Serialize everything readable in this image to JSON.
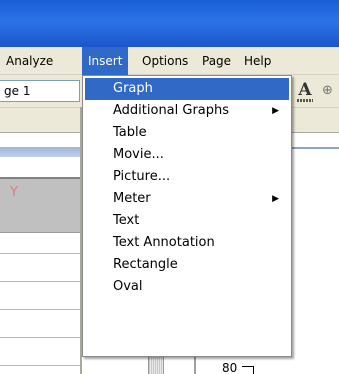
{
  "menubar": {
    "items": [
      {
        "label": "Analyze"
      },
      {
        "label": "Insert"
      },
      {
        "label": "Options"
      },
      {
        "label": "Page"
      },
      {
        "label": "Help"
      }
    ]
  },
  "toolbar": {
    "page_value": "ge 1",
    "font_color_glyph": "A",
    "zoom_glyph": "⊕"
  },
  "left_panel": {
    "column_header": "Y"
  },
  "graph": {
    "tick_label": "80"
  },
  "insert_menu": {
    "items": [
      {
        "label": "Graph",
        "highlighted": true
      },
      {
        "label": "Additional Graphs",
        "submenu": "▶"
      },
      {
        "label": "Table"
      },
      {
        "label": "Movie..."
      },
      {
        "label": "Picture..."
      },
      {
        "label": "Meter",
        "submenu": "▶"
      },
      {
        "label": "Text"
      },
      {
        "label": "Text Annotation"
      },
      {
        "label": "Rectangle"
      },
      {
        "label": "Oval"
      }
    ]
  },
  "colors": {
    "menu_highlight": "#3169c6",
    "title_bar": "#2b73e6",
    "menubar_bg": "#ece9d8"
  }
}
